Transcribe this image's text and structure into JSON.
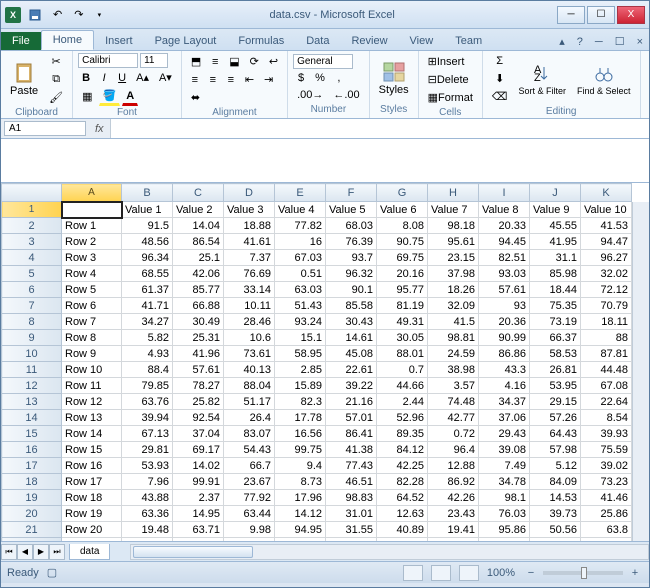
{
  "window": {
    "title": "data.csv - Microsoft Excel"
  },
  "tabs": [
    "File",
    "Home",
    "Insert",
    "Page Layout",
    "Formulas",
    "Data",
    "Review",
    "View",
    "Team"
  ],
  "active_tab": "Home",
  "ribbon": {
    "clipboard": {
      "label": "Clipboard",
      "paste": "Paste"
    },
    "font": {
      "label": "Font",
      "name": "Calibri",
      "size": "11",
      "bold": "B",
      "italic": "I",
      "under": "U"
    },
    "alignment": {
      "label": "Alignment"
    },
    "number": {
      "label": "Number",
      "format": "General",
      "currency": "$",
      "percent": "%",
      "comma": ","
    },
    "styles": {
      "label": "Styles",
      "btn": "Styles"
    },
    "cells": {
      "label": "Cells",
      "insert": "Insert",
      "delete": "Delete",
      "format": "Format"
    },
    "editing": {
      "label": "Editing",
      "sort": "Sort & Filter",
      "find": "Find & Select"
    }
  },
  "namebox": "A1",
  "fx_label": "fx",
  "columns": [
    "A",
    "B",
    "C",
    "D",
    "E",
    "F",
    "G",
    "H",
    "I",
    "J",
    "K"
  ],
  "headers": [
    "",
    "Value 1",
    "Value 2",
    "Value 3",
    "Value 4",
    "Value 5",
    "Value 6",
    "Value 7",
    "Value 8",
    "Value 9",
    "Value 10"
  ],
  "rows": [
    [
      "Row 1",
      91.5,
      14.04,
      18.88,
      77.82,
      68.03,
      8.08,
      98.18,
      20.33,
      45.55,
      41.53
    ],
    [
      "Row 2",
      48.56,
      86.54,
      41.61,
      16,
      76.39,
      90.75,
      95.61,
      94.45,
      41.95,
      94.47
    ],
    [
      "Row 3",
      96.34,
      25.1,
      7.37,
      67.03,
      93.7,
      69.75,
      23.15,
      82.51,
      31.1,
      96.27
    ],
    [
      "Row 4",
      68.55,
      42.06,
      76.69,
      0.51,
      96.32,
      20.16,
      37.98,
      93.03,
      85.98,
      32.02
    ],
    [
      "Row 5",
      61.37,
      85.77,
      33.14,
      63.03,
      90.1,
      95.77,
      18.26,
      57.61,
      18.44,
      72.12
    ],
    [
      "Row 6",
      41.71,
      66.88,
      10.11,
      51.43,
      85.58,
      81.19,
      32.09,
      93,
      75.35,
      70.79
    ],
    [
      "Row 7",
      34.27,
      30.49,
      28.46,
      93.24,
      30.43,
      49.31,
      41.5,
      20.36,
      73.19,
      18.11
    ],
    [
      "Row 8",
      5.82,
      25.31,
      10.6,
      15.1,
      14.61,
      30.05,
      98.81,
      90.99,
      66.37,
      88
    ],
    [
      "Row 9",
      4.93,
      41.96,
      73.61,
      58.95,
      45.08,
      88.01,
      24.59,
      86.86,
      58.53,
      87.81
    ],
    [
      "Row 10",
      88.4,
      57.61,
      40.13,
      2.85,
      22.61,
      0.7,
      38.98,
      43.3,
      26.81,
      44.48
    ],
    [
      "Row 11",
      79.85,
      78.27,
      88.04,
      15.89,
      39.22,
      44.66,
      3.57,
      4.16,
      53.95,
      67.08
    ],
    [
      "Row 12",
      63.76,
      25.82,
      51.17,
      82.3,
      21.16,
      2.44,
      74.48,
      34.37,
      29.15,
      22.64
    ],
    [
      "Row 13",
      39.94,
      92.54,
      26.4,
      17.78,
      57.01,
      52.96,
      42.77,
      37.06,
      57.26,
      8.54
    ],
    [
      "Row 14",
      67.13,
      37.04,
      83.07,
      16.56,
      86.41,
      89.35,
      0.72,
      29.43,
      64.43,
      39.93
    ],
    [
      "Row 15",
      29.81,
      69.17,
      54.43,
      99.75,
      41.38,
      84.12,
      96.4,
      39.08,
      57.98,
      75.59
    ],
    [
      "Row 16",
      53.93,
      14.02,
      66.7,
      9.4,
      77.43,
      42.25,
      12.88,
      7.49,
      5.12,
      39.02
    ],
    [
      "Row 17",
      7.96,
      99.91,
      23.67,
      8.73,
      46.51,
      82.28,
      86.92,
      34.78,
      84.09,
      73.23
    ],
    [
      "Row 18",
      43.88,
      2.37,
      77.92,
      17.96,
      98.83,
      64.52,
      42.26,
      98.1,
      14.53,
      41.46
    ],
    [
      "Row 19",
      63.36,
      14.95,
      63.44,
      14.12,
      31.01,
      12.63,
      23.43,
      76.03,
      39.73,
      25.86
    ],
    [
      "Row 20",
      19.48,
      63.71,
      9.98,
      94.95,
      31.55,
      40.89,
      19.41,
      95.86,
      50.56,
      63.8
    ]
  ],
  "sheet_tab": "data",
  "status": {
    "ready": "Ready",
    "zoom": "100%",
    "minus": "−",
    "plus": "+"
  }
}
